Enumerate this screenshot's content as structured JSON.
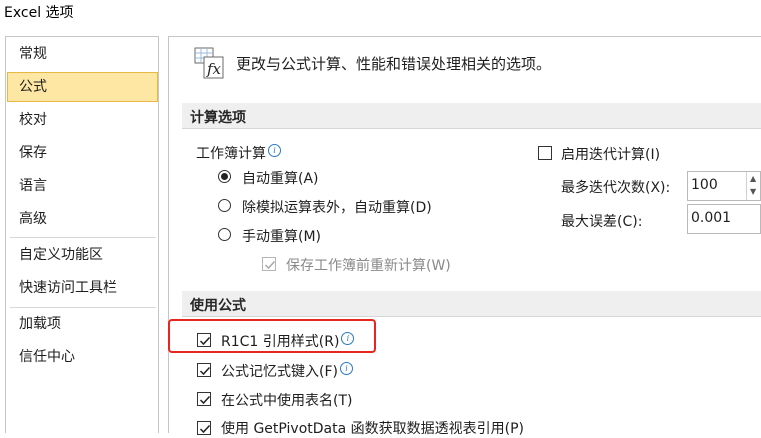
{
  "window": {
    "title": "Excel 选项"
  },
  "nav": {
    "items": [
      "常规",
      "公式",
      "校对",
      "保存",
      "语言",
      "高级",
      "自定义功能区",
      "快速访问工具栏",
      "加载项",
      "信任中心"
    ],
    "selected": "公式"
  },
  "header": {
    "text": "更改与公式计算、性能和错误处理相关的选项。",
    "icon": "formula-icon"
  },
  "calc": {
    "section_title": "计算选项",
    "workbook_label": "工作簿计算",
    "auto": "自动重算(A)",
    "auto_except": "除模拟运算表外，自动重算(D)",
    "manual": "手动重算(M)",
    "recalc_before_save": "保存工作簿前重新计算(W)",
    "iterative": "启用迭代计算(I)",
    "max_iter_label": "最多迭代次数(X):",
    "max_iter_value": "100",
    "max_change_label": "最大误差(C):",
    "max_change_value": "0.001"
  },
  "formulas": {
    "section_title": "使用公式",
    "r1c1": "R1C1 引用样式(R)",
    "autocomplete": "公式记忆式键入(F)",
    "table_names": "在公式中使用表名(T)",
    "getpivotdata": "使用 GetPivotData 函数获取数据透视表引用(P)"
  },
  "colors": {
    "selected_nav": "#fde7a3",
    "highlight": "#e8261f",
    "info": "#2b78c5"
  }
}
